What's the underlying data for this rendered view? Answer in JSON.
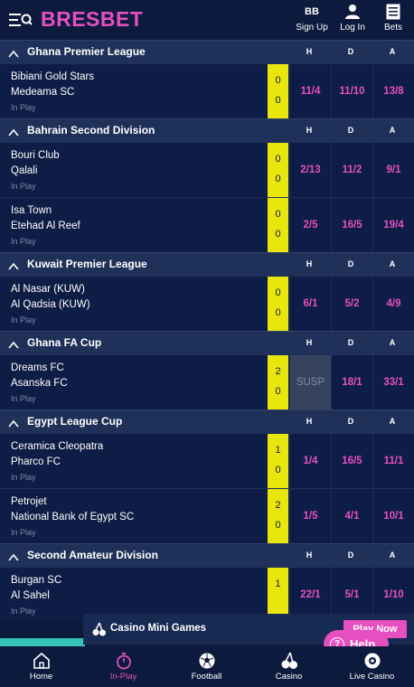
{
  "brand": {
    "logo": "BRESBET"
  },
  "header": {
    "account_initials": "BB",
    "signup": "Sign Up",
    "login": "Log In",
    "bets": "Bets"
  },
  "leagues": [
    {
      "name": "Ghana Premier League",
      "cols": [
        "H",
        "D",
        "A"
      ],
      "matches": [
        {
          "home": "Bibiani Gold Stars",
          "away": "Medeama SC",
          "status": "In Play",
          "score_home": "0",
          "score_away": "0",
          "odds": [
            "11/4",
            "11/10",
            "13/8"
          ]
        }
      ]
    },
    {
      "name": "Bahrain Second Division",
      "cols": [
        "H",
        "D",
        "A"
      ],
      "matches": [
        {
          "home": "Bouri Club",
          "away": "Qalali",
          "status": "In Play",
          "score_home": "0",
          "score_away": "0",
          "odds": [
            "2/13",
            "11/2",
            "9/1"
          ]
        },
        {
          "home": "Isa Town",
          "away": "Etehad Al Reef",
          "status": "In Play",
          "score_home": "0",
          "score_away": "0",
          "odds": [
            "2/5",
            "16/5",
            "19/4"
          ]
        }
      ]
    },
    {
      "name": "Kuwait Premier League",
      "cols": [
        "H",
        "D",
        "A"
      ],
      "matches": [
        {
          "home": "Al Nasar (KUW)",
          "away": "Al Qadsia (KUW)",
          "status": "In Play",
          "score_home": "0",
          "score_away": "0",
          "odds": [
            "6/1",
            "5/2",
            "4/9"
          ]
        }
      ]
    },
    {
      "name": "Ghana FA Cup",
      "cols": [
        "H",
        "D",
        "A"
      ],
      "matches": [
        {
          "home": "Dreams FC",
          "away": "Asanska FC",
          "status": "In Play",
          "score_home": "2",
          "score_away": "0",
          "odds": [
            "SUSP",
            "18/1",
            "33/1"
          ]
        }
      ]
    },
    {
      "name": "Egypt League Cup",
      "cols": [
        "H",
        "D",
        "A"
      ],
      "matches": [
        {
          "home": "Ceramica Cleopatra",
          "away": "Pharco FC",
          "status": "In Play",
          "score_home": "1",
          "score_away": "0",
          "odds": [
            "1/4",
            "16/5",
            "11/1"
          ]
        },
        {
          "home": "Petrojet",
          "away": "National Bank of Egypt SC",
          "status": "In Play",
          "score_home": "2",
          "score_away": "0",
          "odds": [
            "1/5",
            "4/1",
            "10/1"
          ]
        }
      ]
    },
    {
      "name": "Second Amateur Division",
      "cols": [
        "H",
        "D",
        "A"
      ],
      "matches": [
        {
          "home": "Burgan SC",
          "away": "Al Sahel",
          "status": "In Play",
          "score_home": "1",
          "score_away": "",
          "odds": [
            "22/1",
            "5/1",
            "1/10"
          ]
        }
      ]
    }
  ],
  "casino_banner": {
    "title": "Casino Mini Games",
    "cta": "Play Now"
  },
  "help": {
    "label": "Help"
  },
  "bottom_nav": [
    {
      "label": "Home",
      "icon": "home-icon",
      "active": false
    },
    {
      "label": "In-Play",
      "icon": "stopwatch-icon",
      "active": true
    },
    {
      "label": "Football",
      "icon": "football-icon",
      "active": false
    },
    {
      "label": "Casino",
      "icon": "cherries-icon",
      "active": false
    },
    {
      "label": "Live Casino",
      "icon": "live-casino-icon",
      "active": false
    }
  ],
  "colors": {
    "background": "#0c1a3d",
    "league_header": "#1f3158",
    "accent": "#e64fc0",
    "score_bg": "#e8e60d",
    "suspended_bg": "#36435f",
    "teal": "#36c2b4"
  }
}
